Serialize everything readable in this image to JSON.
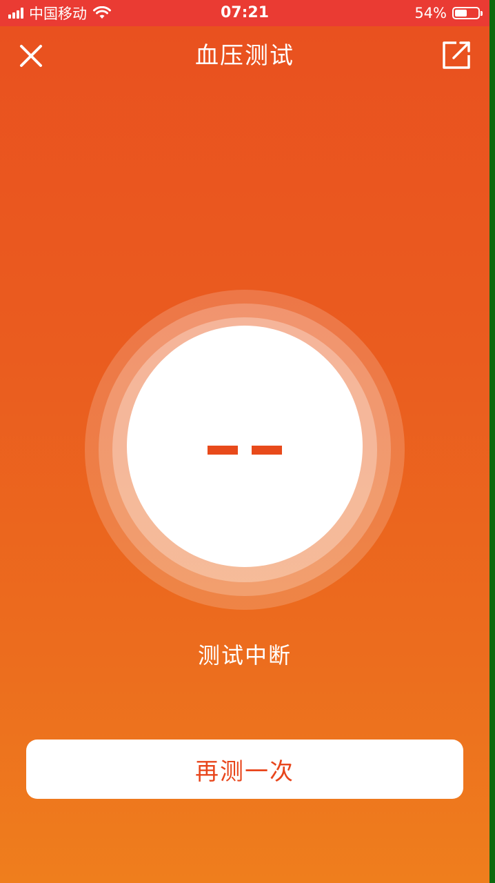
{
  "status_bar": {
    "carrier": "中国移动",
    "time": "07:21",
    "battery_percent": "54%",
    "battery_level": 0.54,
    "icons": [
      "signal-icon",
      "wifi-icon",
      "battery-icon"
    ]
  },
  "nav": {
    "title": "血压测试",
    "close_icon": "close-icon",
    "share_icon": "share-icon"
  },
  "gauge": {
    "reading_first": "--",
    "reading_second": "--",
    "reading_color": "#e84a1b"
  },
  "status_message": "测试中断",
  "retest_button": {
    "label": "再测一次",
    "text_color": "#e8461c"
  },
  "colors": {
    "status_bar_bg": "#ea3b33",
    "gradient_top": "#e9501f",
    "gradient_bottom": "#ef7e1d"
  }
}
